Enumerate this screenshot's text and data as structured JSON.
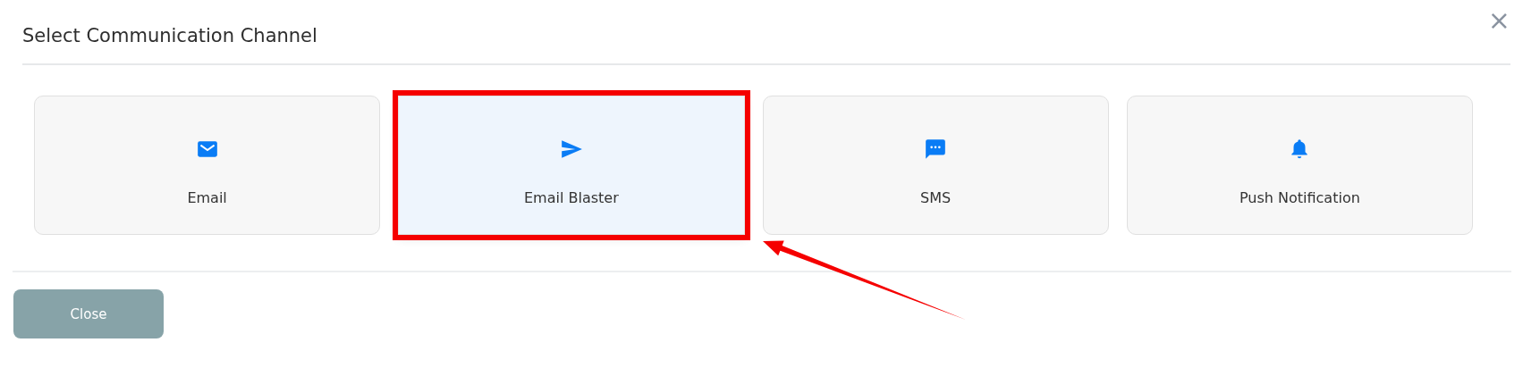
{
  "dialog": {
    "title": "Select Communication Channel",
    "close_icon": "×"
  },
  "channels": [
    {
      "kind": "email",
      "label": "Email",
      "selected": false,
      "highlighted": false
    },
    {
      "kind": "send",
      "label": "Email Blaster",
      "selected": true,
      "highlighted": true
    },
    {
      "kind": "sms",
      "label": "SMS",
      "selected": false,
      "highlighted": false
    },
    {
      "kind": "bell",
      "label": "Push Notification",
      "selected": false,
      "highlighted": false
    }
  ],
  "footer": {
    "close_button": "Close"
  }
}
